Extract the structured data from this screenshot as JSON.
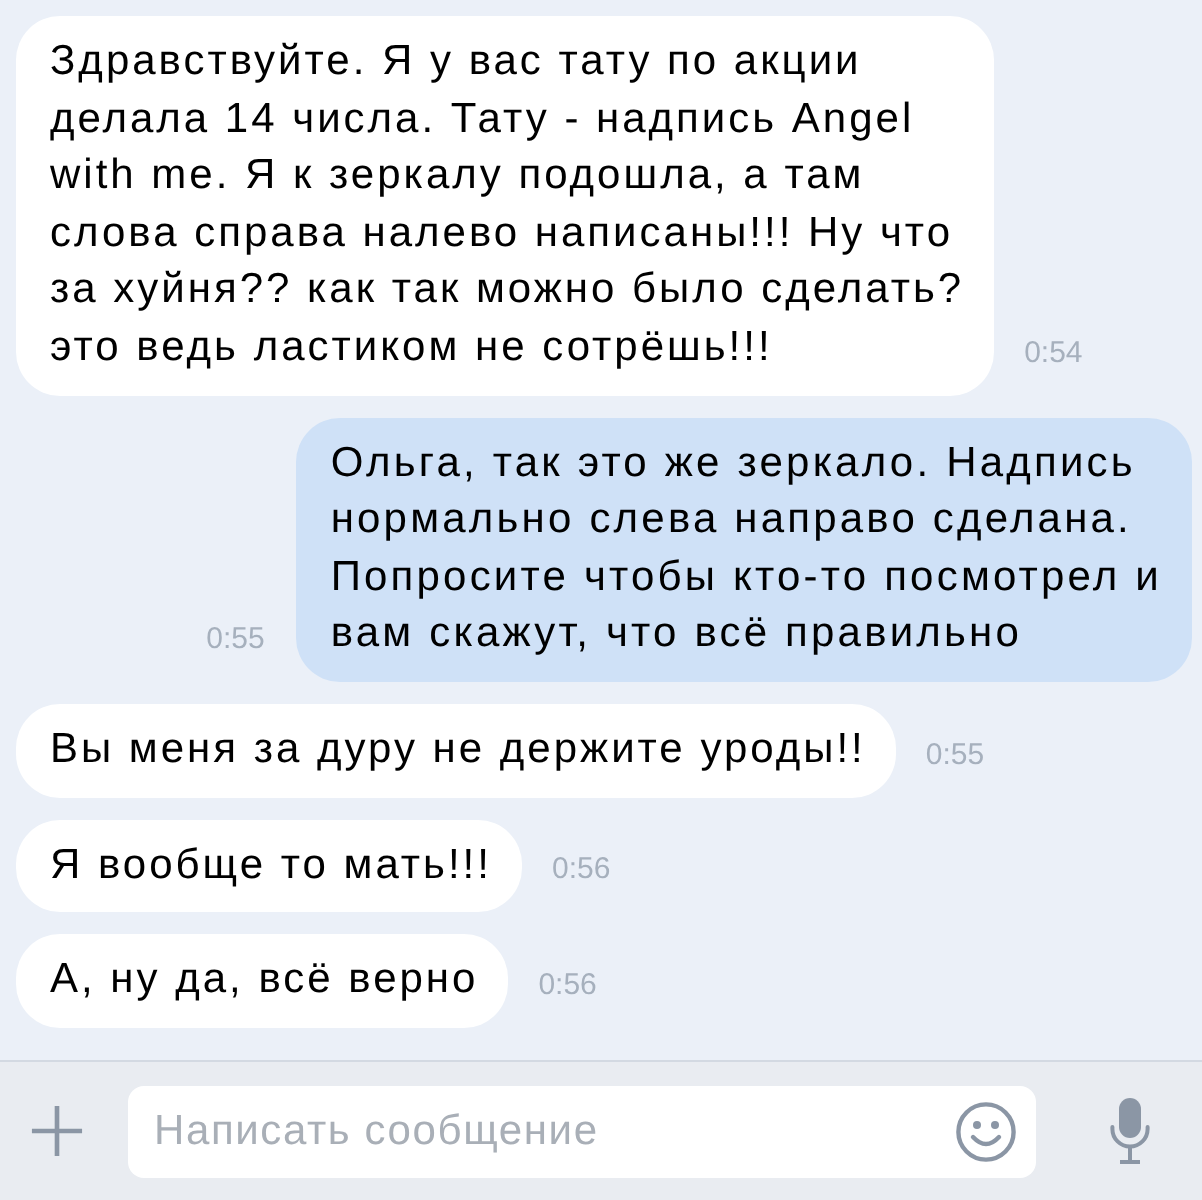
{
  "messages": [
    {
      "kind": "incoming",
      "text": "Здравствуйте. Я у вас тату по акции\nделала 14 числа. Тату - надпись Angel\nwith me. Я к зеркалу подошла, а там\nслова справа налево написаны!!! Ну что\nза хуйня?? как так можно было сделать?\nэто ведь ластиком не сотрёшь!!!",
      "time": "0:54"
    },
    {
      "kind": "outgoing",
      "text": "Ольга, так это же зеркало. Надпись\nнормально слева направо сделана.\nПопросите чтобы кто-то посмотрел и\nвам скажут, что всё правильно",
      "time": "0:55"
    },
    {
      "kind": "incoming",
      "text": "Вы меня за дуру не держите уроды!!",
      "time": "0:55"
    },
    {
      "kind": "incoming",
      "text": "Я вообще то мать!!!",
      "time": "0:56"
    },
    {
      "kind": "incoming",
      "text": "А, ну да, всё верно",
      "time": "0:56"
    }
  ],
  "composer": {
    "placeholder": "Написать сообщение"
  }
}
